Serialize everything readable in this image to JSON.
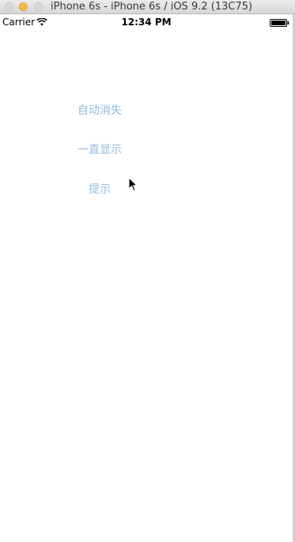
{
  "window": {
    "title": "iPhone 6s - iPhone 6s / iOS 9.2 (13C75)"
  },
  "status_bar": {
    "carrier": "Carrier",
    "time": "12:34 PM",
    "wifi_icon": "wifi-icon",
    "battery_icon": "battery-icon"
  },
  "buttons": [
    {
      "label": "自动消失"
    },
    {
      "label": "一直显示"
    },
    {
      "label": "提示"
    }
  ],
  "colors": {
    "button_text": "#8dbbe0",
    "background": "#ffffff"
  },
  "cursor": "arrow-cursor-icon"
}
